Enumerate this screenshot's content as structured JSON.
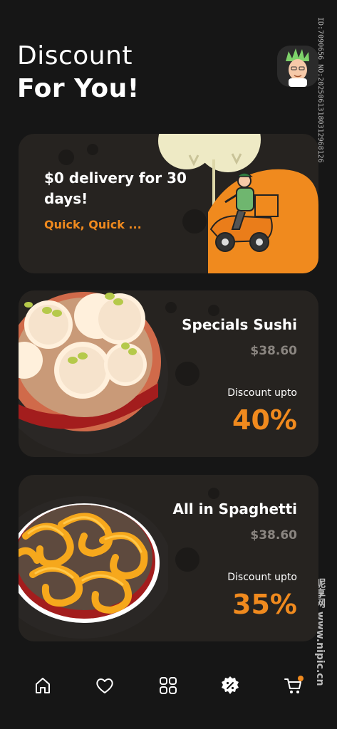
{
  "header": {
    "title_line1": "Discount",
    "title_line2": "For You!"
  },
  "watermark": {
    "id_text": "ID:7090656 NO:20250613180312968126",
    "site_text": "昵享网 www.nipic.cn"
  },
  "promo": {
    "title": "$0 delivery for 30 days!",
    "subtitle": "Quick, Quick ..."
  },
  "offers": [
    {
      "name": "Specials Sushi",
      "price": "$38.60",
      "discount_label": "Discount upto",
      "discount": "40%"
    },
    {
      "name": "All in Spaghetti",
      "price": "$38.60",
      "discount_label": "Discount upto",
      "discount": "35%"
    }
  ],
  "nav": {
    "items": [
      {
        "icon": "home-icon",
        "active": false
      },
      {
        "icon": "heart-icon",
        "active": false
      },
      {
        "icon": "grid-icon",
        "active": false
      },
      {
        "icon": "discount-badge-icon",
        "active": true
      },
      {
        "icon": "cart-icon",
        "active": false,
        "badge": true
      }
    ]
  },
  "colors": {
    "background": "#161616",
    "card": "#262320",
    "accent": "#f08a1e",
    "muted": "#8a8580"
  }
}
